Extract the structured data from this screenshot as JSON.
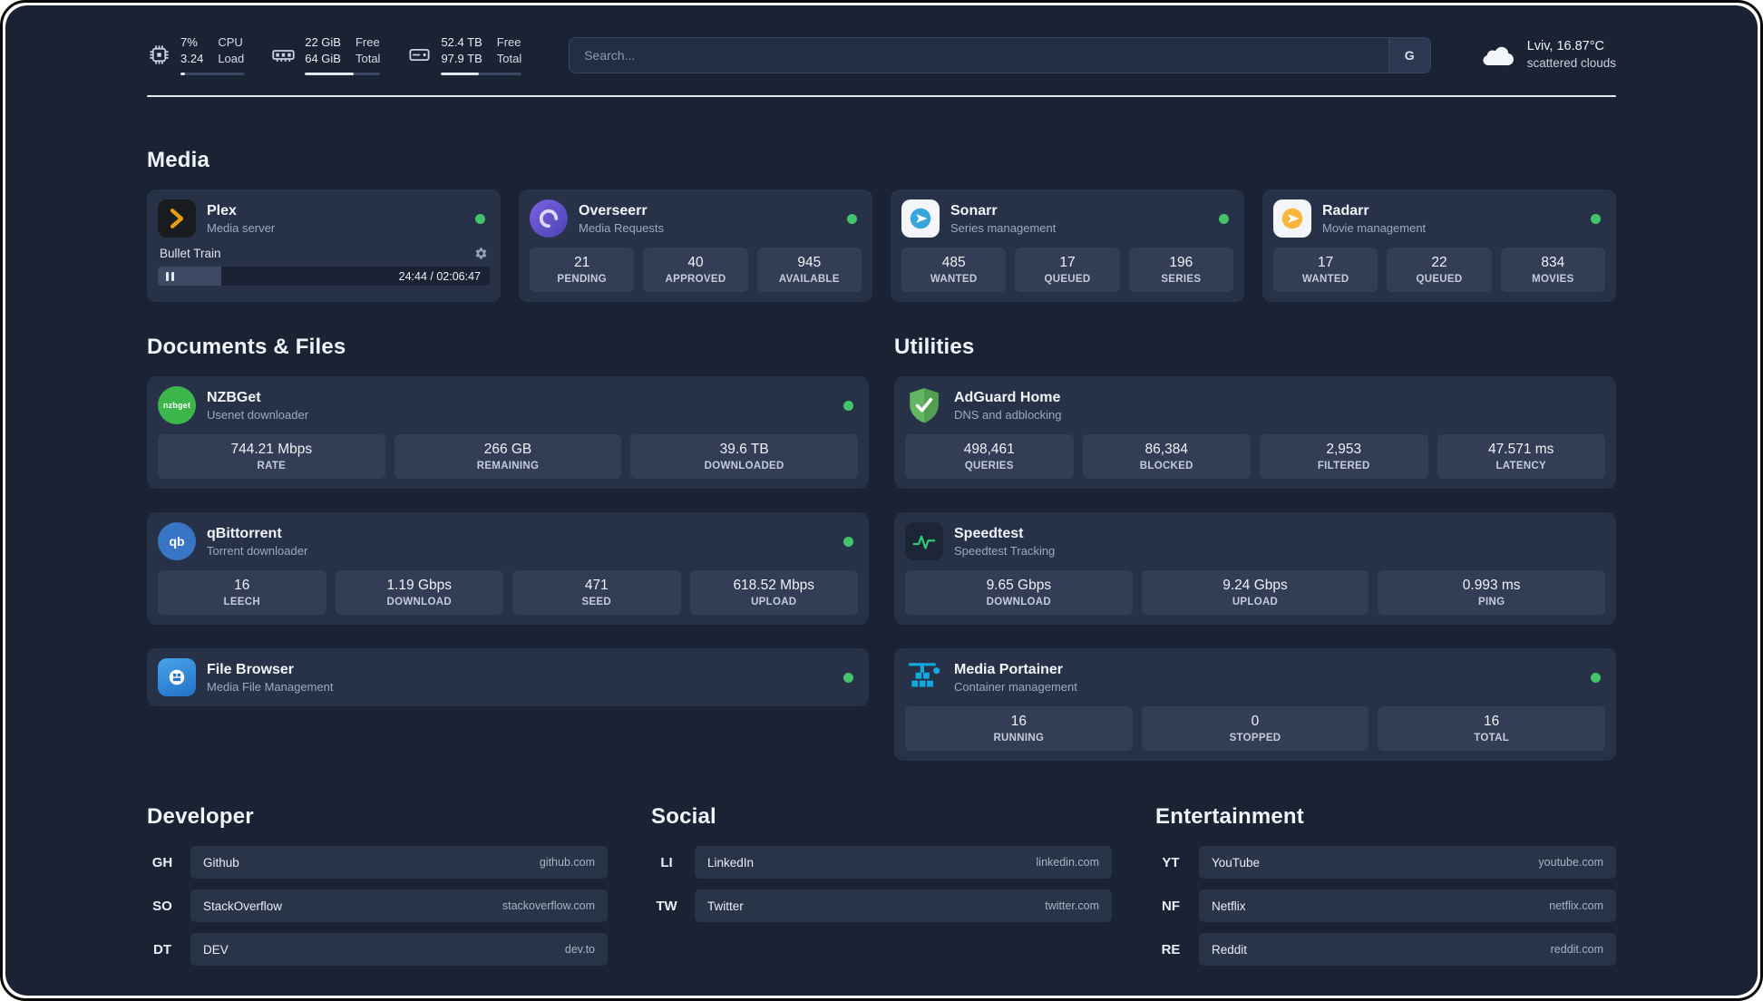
{
  "topbar": {
    "cpu": {
      "values": [
        "7%",
        "3.24"
      ],
      "labels": [
        "CPU",
        "Load"
      ],
      "bar_percent": 7
    },
    "ram": {
      "values": [
        "22 GiB",
        "64 GiB"
      ],
      "labels": [
        "Free",
        "Total"
      ],
      "bar_percent": 65
    },
    "disk": {
      "values": [
        "52.4 TB",
        "97.9 TB"
      ],
      "labels": [
        "Free",
        "Total"
      ],
      "bar_percent": 47
    },
    "search": {
      "placeholder": "Search...",
      "button_label": "G"
    },
    "weather": {
      "location": "Lviv, 16.87°C",
      "condition": "scattered clouds"
    }
  },
  "sections": {
    "media": {
      "title": "Media"
    },
    "files": {
      "title": "Documents & Files"
    },
    "utilities": {
      "title": "Utilities"
    }
  },
  "media_cards": [
    {
      "name": "Plex",
      "desc": "Media server",
      "icon": "plex",
      "online": true,
      "player": {
        "title": "Bullet Train",
        "time": "24:44 / 02:06:47",
        "progress_percent": 19
      }
    },
    {
      "name": "Overseerr",
      "desc": "Media Requests",
      "icon": "overseerr",
      "online": true,
      "stats": [
        {
          "value": "21",
          "label": "PENDING"
        },
        {
          "value": "40",
          "label": "APPROVED"
        },
        {
          "value": "945",
          "label": "AVAILABLE"
        }
      ]
    },
    {
      "name": "Sonarr",
      "desc": "Series management",
      "icon": "sonarr",
      "online": true,
      "stats": [
        {
          "value": "485",
          "label": "WANTED"
        },
        {
          "value": "17",
          "label": "QUEUED"
        },
        {
          "value": "196",
          "label": "SERIES"
        }
      ]
    },
    {
      "name": "Radarr",
      "desc": "Movie management",
      "icon": "radarr",
      "online": true,
      "stats": [
        {
          "value": "17",
          "label": "WANTED"
        },
        {
          "value": "22",
          "label": "QUEUED"
        },
        {
          "value": "834",
          "label": "MOVIES"
        }
      ]
    }
  ],
  "files_cards": [
    {
      "name": "NZBGet",
      "desc": "Usenet downloader",
      "icon": "nzbget",
      "online": true,
      "stats": [
        {
          "value": "744.21 Mbps",
          "label": "RATE"
        },
        {
          "value": "266 GB",
          "label": "REMAINING"
        },
        {
          "value": "39.6 TB",
          "label": "DOWNLOADED"
        }
      ]
    },
    {
      "name": "qBittorrent",
      "desc": "Torrent downloader",
      "icon": "qbittorrent",
      "online": true,
      "stats": [
        {
          "value": "16",
          "label": "LEECH"
        },
        {
          "value": "1.19 Gbps",
          "label": "DOWNLOAD"
        },
        {
          "value": "471",
          "label": "SEED"
        },
        {
          "value": "618.52 Mbps",
          "label": "UPLOAD"
        }
      ]
    },
    {
      "name": "File Browser",
      "desc": "Media File Management",
      "icon": "filebrowser",
      "online": true
    }
  ],
  "utility_cards": [
    {
      "name": "AdGuard Home",
      "desc": "DNS and adblocking",
      "icon": "adguard",
      "online": false,
      "stats": [
        {
          "value": "498,461",
          "label": "QUERIES"
        },
        {
          "value": "86,384",
          "label": "BLOCKED"
        },
        {
          "value": "2,953",
          "label": "FILTERED"
        },
        {
          "value": "47.571 ms",
          "label": "LATENCY"
        }
      ]
    },
    {
      "name": "Speedtest",
      "desc": "Speedtest Tracking",
      "icon": "speedtest",
      "online": false,
      "stats": [
        {
          "value": "9.65 Gbps",
          "label": "DOWNLOAD"
        },
        {
          "value": "9.24 Gbps",
          "label": "UPLOAD"
        },
        {
          "value": "0.993 ms",
          "label": "PING"
        }
      ]
    },
    {
      "name": "Media Portainer",
      "desc": "Container management",
      "icon": "portainer",
      "online": true,
      "stats": [
        {
          "value": "16",
          "label": "RUNNING"
        },
        {
          "value": "0",
          "label": "STOPPED"
        },
        {
          "value": "16",
          "label": "TOTAL"
        }
      ]
    }
  ],
  "bookmark_groups": [
    {
      "title": "Developer",
      "items": [
        {
          "abbr": "GH",
          "name": "Github",
          "url": "github.com"
        },
        {
          "abbr": "SO",
          "name": "StackOverflow",
          "url": "stackoverflow.com"
        },
        {
          "abbr": "DT",
          "name": "DEV",
          "url": "dev.to"
        }
      ]
    },
    {
      "title": "Social",
      "items": [
        {
          "abbr": "LI",
          "name": "LinkedIn",
          "url": "linkedin.com"
        },
        {
          "abbr": "TW",
          "name": "Twitter",
          "url": "twitter.com"
        }
      ]
    },
    {
      "title": "Entertainment",
      "items": [
        {
          "abbr": "YT",
          "name": "YouTube",
          "url": "youtube.com"
        },
        {
          "abbr": "NF",
          "name": "Netflix",
          "url": "netflix.com"
        },
        {
          "abbr": "RE",
          "name": "Reddit",
          "url": "reddit.com"
        }
      ]
    }
  ]
}
